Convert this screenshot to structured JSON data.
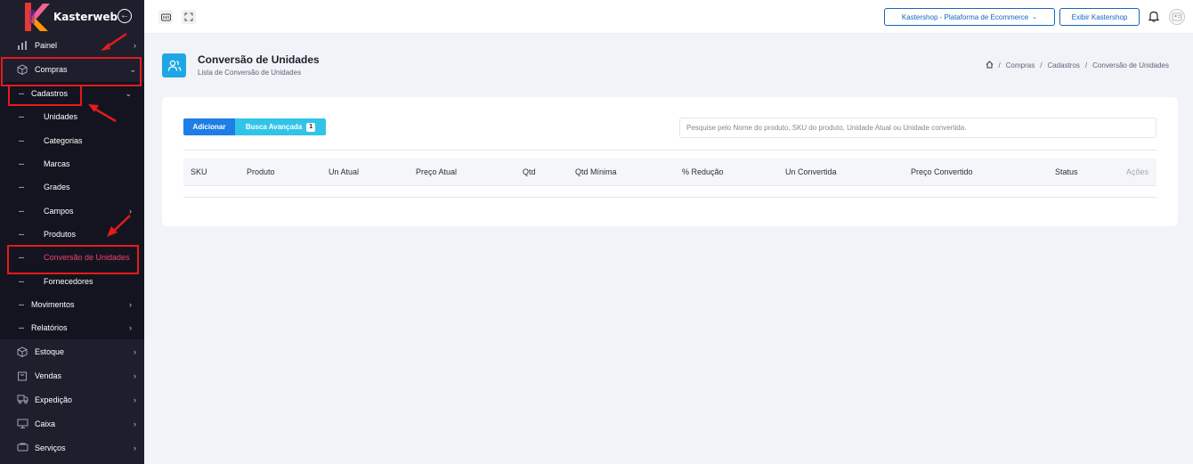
{
  "brand": {
    "name": "Kasterweb"
  },
  "sidebar": {
    "items": [
      {
        "label": "Painel",
        "icon": "bar-chart-icon"
      },
      {
        "label": "Compras",
        "icon": "box-icon"
      },
      {
        "label": "Cadastros",
        "prefix": "--"
      },
      {
        "label": "Unidades",
        "prefix": "--"
      },
      {
        "label": "Categorias",
        "prefix": "--"
      },
      {
        "label": "Marcas",
        "prefix": "--"
      },
      {
        "label": "Grades",
        "prefix": "--"
      },
      {
        "label": "Campos",
        "prefix": "--"
      },
      {
        "label": "Produtos",
        "prefix": "--"
      },
      {
        "label": "Conversão de Unidades",
        "prefix": "--"
      },
      {
        "label": "Fornecedores",
        "prefix": "--"
      },
      {
        "label": "Movimentos",
        "prefix": "--"
      },
      {
        "label": "Relatórios",
        "prefix": "--"
      },
      {
        "label": "Estoque",
        "icon": "cube-icon"
      },
      {
        "label": "Vendas",
        "icon": "cart-icon"
      },
      {
        "label": "Expedição",
        "icon": "truck-icon"
      },
      {
        "label": "Caixa",
        "icon": "monitor-icon"
      },
      {
        "label": "Serviços",
        "icon": "tools-icon"
      }
    ]
  },
  "topbar": {
    "store_select": "Kastershop - Plataforma de Ecommerce",
    "show_button": "Exibir Kastershop"
  },
  "page": {
    "title": "Conversão de Unidades",
    "subtitle": "Lista de Conversão de Unidades",
    "breadcrumb": [
      "Compras",
      "Cadastros",
      "Conversão de Unidades"
    ],
    "breadcrumb_sep": "/"
  },
  "toolbar": {
    "add_label": "Adicionar",
    "advanced_search_label": "Busca Avançada",
    "advanced_search_count": "1",
    "search_placeholder": "Pesquise pelo Nome do produto, SKU do produto, Unidade Atual ou Unidade convertida."
  },
  "table": {
    "columns": [
      "SKU",
      "Produto",
      "Un Atual",
      "Preço Atual",
      "Qtd",
      "Qtd Mínima",
      "% Redução",
      "Un Convertida",
      "Preço Convertido",
      "Status",
      "Ações"
    ]
  },
  "colors": {
    "sidebar_bg": "#1e1e2d",
    "active_item": "#f1416c",
    "primary": "#1e7ee6",
    "info": "#31c4e8",
    "annotation_red": "#e31b1b"
  }
}
